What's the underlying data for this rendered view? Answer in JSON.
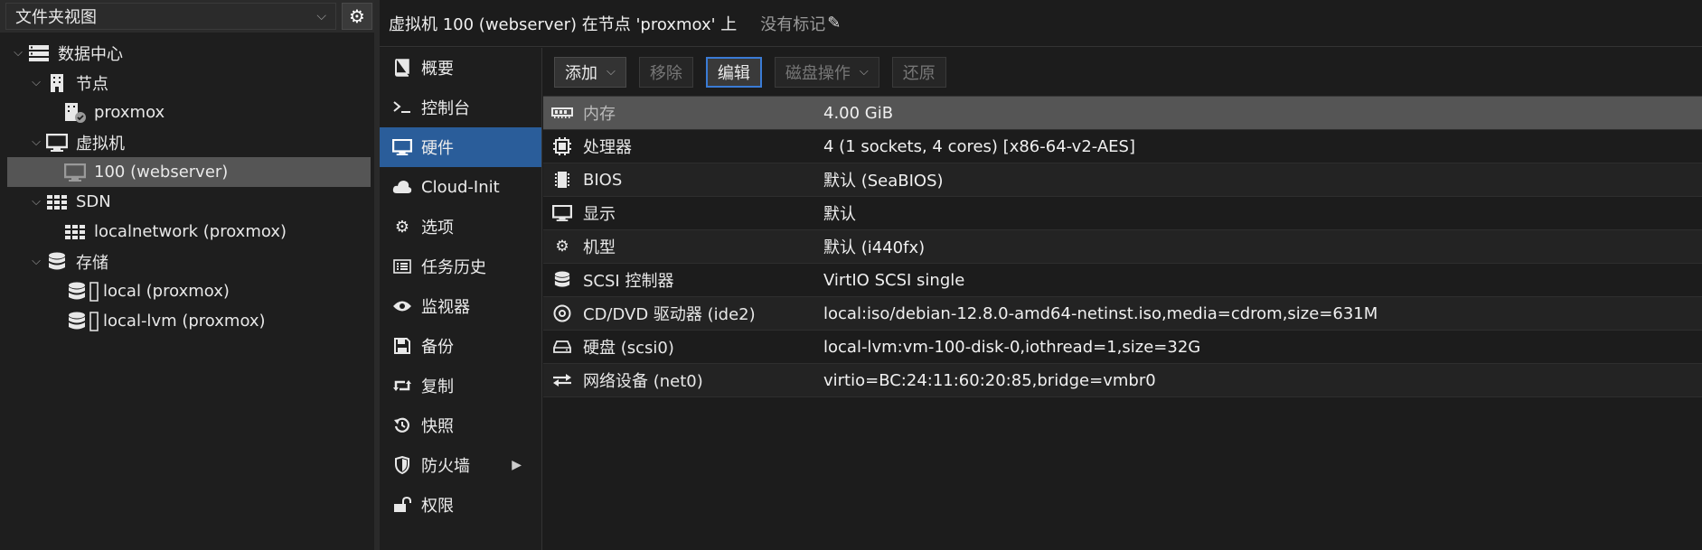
{
  "left_panel": {
    "view_selector": "文件夹视图",
    "tree": [
      {
        "label": "数据中心",
        "icon": "server-stack-icon",
        "level": 0
      },
      {
        "label": "节点",
        "icon": "building-icon",
        "level": 1
      },
      {
        "label": "proxmox",
        "icon": "node-check-icon",
        "level": 2
      },
      {
        "label": "虚拟机",
        "icon": "monitor-icon",
        "level": 1
      },
      {
        "label": "100 (webserver)",
        "icon": "vm-stopped-icon",
        "level": 2
      },
      {
        "label": "SDN",
        "icon": "grid-icon",
        "level": 1
      },
      {
        "label": "localnetwork (proxmox)",
        "icon": "grid-icon",
        "level": 2
      },
      {
        "label": "存储",
        "icon": "database-icon",
        "level": 1
      },
      {
        "label": "local (proxmox)",
        "icon": "storage-icon",
        "level": 2
      },
      {
        "label": "local-lvm (proxmox)",
        "icon": "storage-icon",
        "level": 2
      }
    ]
  },
  "header": {
    "title": "虚拟机 100 (webserver) 在节点 'proxmox' 上",
    "tags": "没有标记"
  },
  "subnav": {
    "items": [
      {
        "label": "概要",
        "icon": "book-icon"
      },
      {
        "label": "控制台",
        "icon": "terminal-icon"
      },
      {
        "label": "硬件",
        "icon": "monitor-icon",
        "active": true
      },
      {
        "label": "Cloud-Init",
        "icon": "cloud-icon"
      },
      {
        "label": "选项",
        "icon": "gear-icon"
      },
      {
        "label": "任务历史",
        "icon": "list-icon"
      },
      {
        "label": "监视器",
        "icon": "eye-icon"
      },
      {
        "label": "备份",
        "icon": "floppy-icon"
      },
      {
        "label": "复制",
        "icon": "retweet-icon"
      },
      {
        "label": "快照",
        "icon": "history-icon"
      },
      {
        "label": "防火墙",
        "icon": "shield-icon"
      },
      {
        "label": "权限",
        "icon": "unlock-icon"
      }
    ]
  },
  "toolbar": {
    "add": "添加",
    "remove": "移除",
    "edit": "编辑",
    "disk_action": "磁盘操作",
    "revert": "还原"
  },
  "hardware": [
    {
      "name": "内存",
      "value": "4.00 GiB",
      "icon": "memory-icon"
    },
    {
      "name": "处理器",
      "value": "4 (1 sockets, 4 cores) [x86-64-v2-AES]",
      "icon": "cpu-icon"
    },
    {
      "name": "BIOS",
      "value": "默认 (SeaBIOS)",
      "icon": "microchip-icon"
    },
    {
      "name": "显示",
      "value": "默认",
      "icon": "desktop-icon"
    },
    {
      "name": "机型",
      "value": "默认 (i440fx)",
      "icon": "cogs-icon"
    },
    {
      "name": "SCSI 控制器",
      "value": "VirtIO SCSI single",
      "icon": "database-icon"
    },
    {
      "name": "CD/DVD 驱动器 (ide2)",
      "value": "local:iso/debian-12.8.0-amd64-netinst.iso,media=cdrom,size=631M",
      "icon": "cdrom-icon"
    },
    {
      "name": "硬盘 (scsi0)",
      "value": "local-lvm:vm-100-disk-0,iothread=1,size=32G",
      "icon": "hdd-icon"
    },
    {
      "name": "网络设备 (net0)",
      "value": "virtio=BC:24:11:60:20:85,bridge=vmbr0",
      "icon": "exchange-icon"
    }
  ]
}
